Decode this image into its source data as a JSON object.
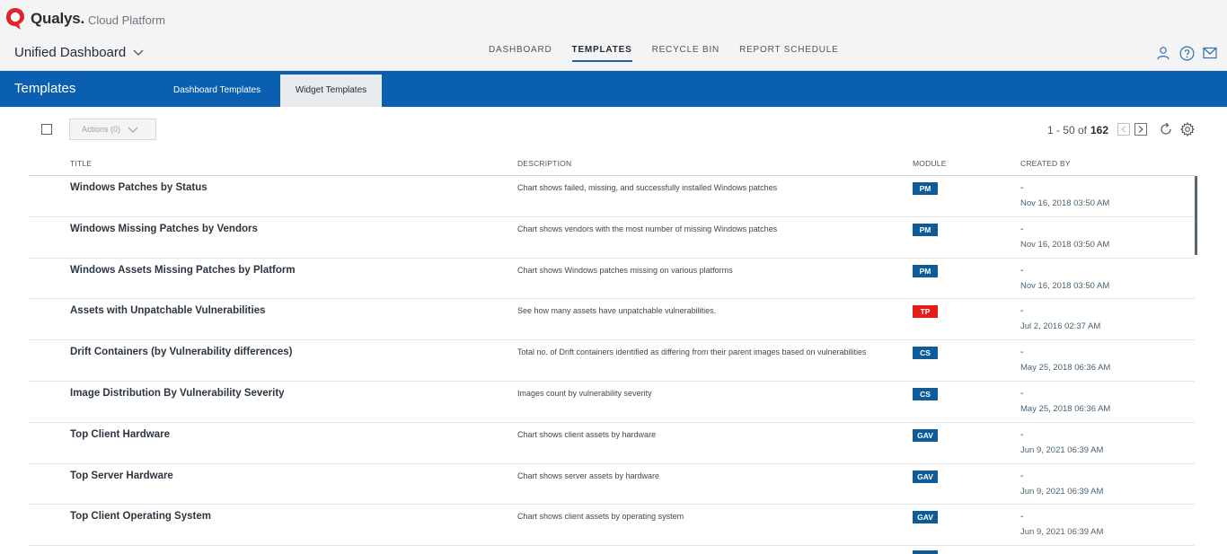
{
  "brand": {
    "name": "Qualys.",
    "sub": "Cloud Platform"
  },
  "app_switcher": {
    "title": "Unified Dashboard"
  },
  "nav": {
    "tabs": [
      {
        "label": "DASHBOARD",
        "active": false
      },
      {
        "label": "TEMPLATES",
        "active": true
      },
      {
        "label": "RECYCLE BIN",
        "active": false
      },
      {
        "label": "REPORT SCHEDULE",
        "active": false
      }
    ]
  },
  "header_icons": [
    "user-icon",
    "help-icon",
    "mail-icon"
  ],
  "subheader": {
    "title": "Templates",
    "tabs": [
      {
        "label": "Dashboard Templates",
        "active": false
      },
      {
        "label": "Widget Templates",
        "active": true
      }
    ]
  },
  "toolbar": {
    "actions_label": "Actions (0)"
  },
  "pagination": {
    "range": "1 - 50 of",
    "total": "162"
  },
  "colors": {
    "brand_red": "#e3222b",
    "primary_blue": "#0a5fb0",
    "badge_blue": "#0d5c99",
    "badge_red": "#e81b1b"
  },
  "table": {
    "columns": {
      "title": "TITLE",
      "description": "DESCRIPTION",
      "module": "MODULE",
      "created_by": "CREATED BY"
    },
    "rows": [
      {
        "title": "Windows Patches by Status",
        "description": "Chart shows failed, missing, and successfully installed Windows patches",
        "module": "PM",
        "module_color": "#0d5c99",
        "creator": "-",
        "date": "Nov 16, 2018 03:50 AM"
      },
      {
        "title": "Windows Missing Patches by Vendors",
        "description": "Chart shows vendors with the most number of missing Windows patches",
        "module": "PM",
        "module_color": "#0d5c99",
        "creator": "-",
        "date": "Nov 16, 2018 03:50 AM"
      },
      {
        "title": "Windows Assets Missing Patches by Platform",
        "description": "Chart shows Windows patches missing on various platforms",
        "module": "PM",
        "module_color": "#0d5c99",
        "creator": "-",
        "date": "Nov 16, 2018 03:50 AM"
      },
      {
        "title": "Assets with Unpatchable Vulnerabilities",
        "description": "See how many assets have unpatchable vulnerabilities.",
        "module": "TP",
        "module_color": "#e81b1b",
        "creator": "-",
        "date": "Jul 2, 2016 02:37 AM"
      },
      {
        "title": "Drift Containers (by Vulnerability differences)",
        "description": "Total no. of Drift containers identified as differing from their parent images based on vulnerabilities",
        "module": "CS",
        "module_color": "#0d5c99",
        "creator": "-",
        "date": "May 25, 2018 06:36 AM"
      },
      {
        "title": "Image Distribution By Vulnerability Severity",
        "description": "Images count by vulnerability severity",
        "module": "CS",
        "module_color": "#0d5c99",
        "creator": "-",
        "date": "May 25, 2018 06:36 AM"
      },
      {
        "title": "Top Client Hardware",
        "description": "Chart shows client assets by hardware",
        "module": "GAV",
        "module_color": "#0d5c99",
        "creator": "-",
        "date": "Jun 9, 2021 06:39 AM"
      },
      {
        "title": "Top Server Hardware",
        "description": "Chart shows server assets by hardware",
        "module": "GAV",
        "module_color": "#0d5c99",
        "creator": "-",
        "date": "Jun 9, 2021 06:39 AM"
      },
      {
        "title": "Top Client Operating System",
        "description": "Chart shows client assets by operating system",
        "module": "GAV",
        "module_color": "#0d5c99",
        "creator": "-",
        "date": "Jun 9, 2021 06:39 AM"
      }
    ]
  }
}
